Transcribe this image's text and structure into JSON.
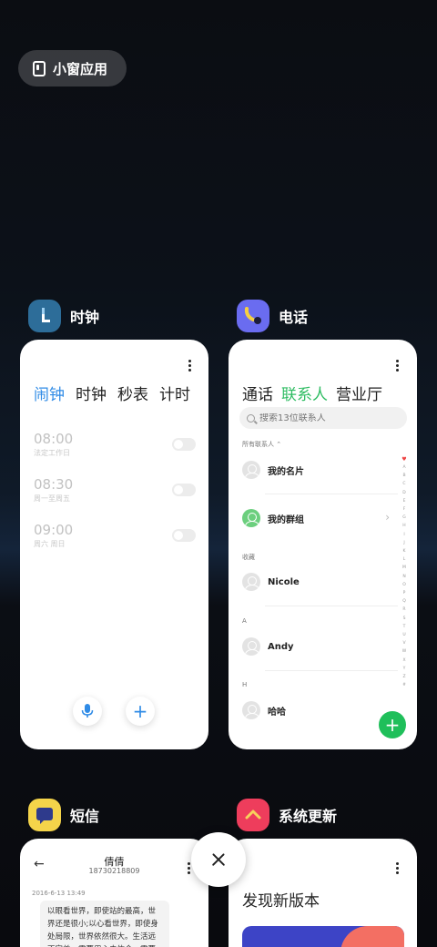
{
  "small_window": {
    "label": "小窗应用"
  },
  "apps": {
    "clock": {
      "name": "时钟",
      "tabs": [
        "闹钟",
        "时钟",
        "秒表",
        "计时"
      ],
      "active_tab": 0,
      "alarms": [
        {
          "time": "08:00",
          "repeat": "法定工作日",
          "enabled": false
        },
        {
          "time": "08:30",
          "repeat": "周一至周五",
          "enabled": false
        },
        {
          "time": "09:00",
          "repeat": "周六 周日",
          "enabled": false
        }
      ],
      "accent": "#2f8be6"
    },
    "phone": {
      "name": "电话",
      "tabs": [
        "通话",
        "联系人",
        "营业厅"
      ],
      "active_tab": 1,
      "search_placeholder": "搜索13位联系人",
      "all_contacts_label": "所有联系人",
      "my_card": "我的名片",
      "my_group": "我的群组",
      "favorites_label": "收藏",
      "favorite_contact": "Nicole",
      "section_a": "A",
      "contact_a": "Andy",
      "section_h": "H",
      "contact_h": "哈哈",
      "index": [
        "A",
        "B",
        "C",
        "D",
        "E",
        "F",
        "G",
        "H",
        "I",
        "J",
        "K",
        "L",
        "M",
        "N",
        "O",
        "P",
        "Q",
        "R",
        "S",
        "T",
        "U",
        "V",
        "W",
        "X",
        "Y",
        "Z",
        "#"
      ],
      "accent": "#2ebc62"
    },
    "sms": {
      "name": "短信",
      "contact_name": "倩倩",
      "contact_number": "18730218809",
      "timestamp": "2016-6-13 13:49",
      "message": "以眼看世界，即使站的最高，世界还是很小;以心看世界，即使身处局限，世界依然很大。生活远不完美，需要用心去体会，需要用心去"
    },
    "update": {
      "name": "系统更新",
      "title": "发现新版本"
    }
  }
}
